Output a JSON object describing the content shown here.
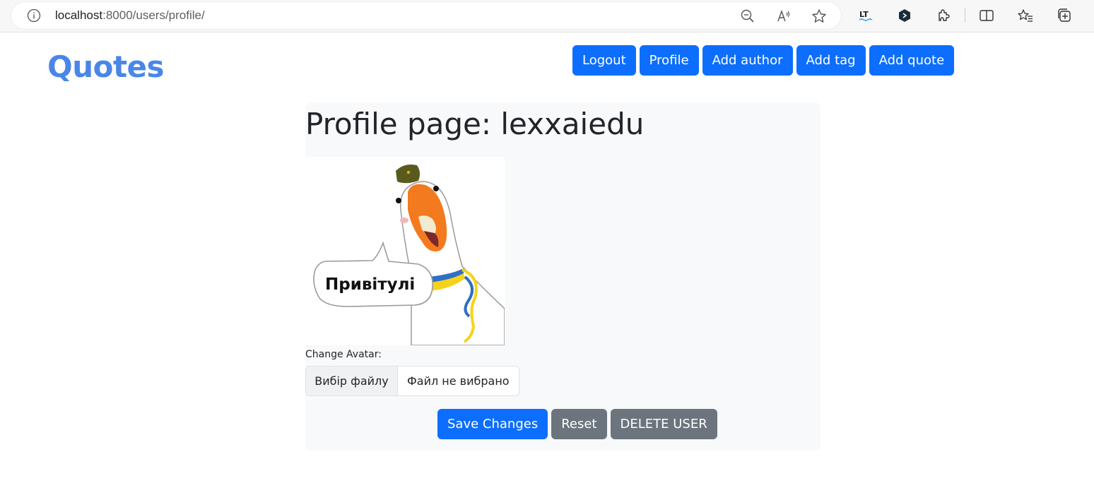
{
  "browser": {
    "url_host": "localhost",
    "url_path": ":8000/users/profile/",
    "icons": [
      "info-icon",
      "zoom-out-icon",
      "read-aloud-icon",
      "favorite-star-icon",
      "languagetool-extension-icon",
      "shield-extension-icon",
      "extensions-puzzle-icon",
      "split-screen-icon",
      "favorites-icon",
      "collections-icon"
    ]
  },
  "header": {
    "brand": "Quotes",
    "nav": [
      "Logout",
      "Profile",
      "Add author",
      "Add tag",
      "Add quote"
    ]
  },
  "profile": {
    "title": "Profile page: lexxaiedu",
    "avatar_caption": "Привітулі",
    "change_avatar_label": "Change Avatar:",
    "file_button": "Вибір файлу",
    "file_status": "Файл не вибрано",
    "save_button": "Save Changes",
    "reset_button": "Reset",
    "delete_button": "DELETE USER"
  },
  "colors": {
    "primary": "#0d6efd",
    "secondary": "#6c757d",
    "brand": "#4a86e8",
    "card_bg": "#f8f9fa"
  }
}
